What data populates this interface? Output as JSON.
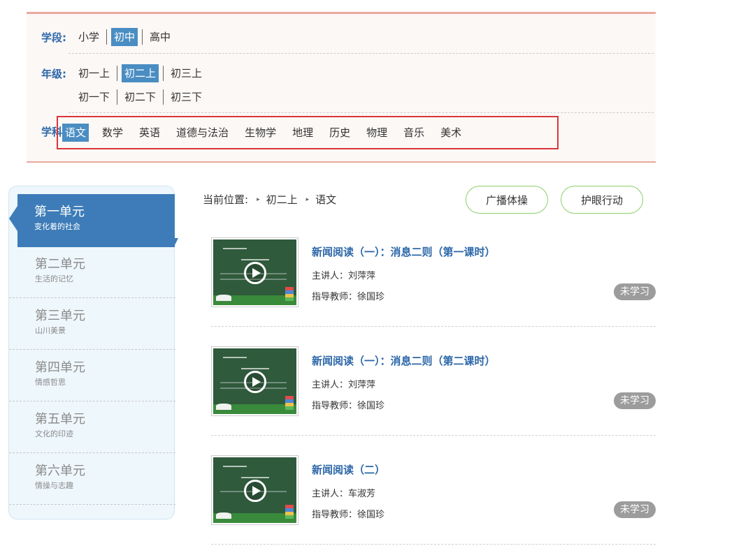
{
  "filters": {
    "stage": {
      "label": "学段:",
      "options": [
        "小学",
        "初中",
        "高中"
      ],
      "selected": "初中"
    },
    "grade": {
      "label": "年级:",
      "row1": [
        "初一上",
        "初二上",
        "初三上"
      ],
      "row2": [
        "初一下",
        "初二下",
        "初三下"
      ],
      "selected": "初二上"
    },
    "subject": {
      "label": "学科:",
      "options": [
        "语文",
        "数学",
        "英语",
        "道德与法治",
        "生物学",
        "地理",
        "历史",
        "物理",
        "音乐",
        "美术"
      ],
      "selected": "语文"
    }
  },
  "units": [
    {
      "title": "第一单元",
      "subtitle": "变化着的社会",
      "active": true
    },
    {
      "title": "第二单元",
      "subtitle": "生活的记忆",
      "active": false
    },
    {
      "title": "第三单元",
      "subtitle": "山川美景",
      "active": false
    },
    {
      "title": "第四单元",
      "subtitle": "情感哲思",
      "active": false
    },
    {
      "title": "第五单元",
      "subtitle": "文化的印迹",
      "active": false
    },
    {
      "title": "第六单元",
      "subtitle": "情操与志趣",
      "active": false
    }
  ],
  "breadcrumb": {
    "label": "当前位置:",
    "grade": "初二上",
    "subject": "语文"
  },
  "actions": {
    "exercise": "广播体操",
    "eye_care": "护眼行动"
  },
  "lessons": [
    {
      "title": "新闻阅读（一）：消息二则（第一课时）",
      "presenter": "主讲人：刘萍萍",
      "advisor": "指导教师：徐国珍",
      "status": "未学习"
    },
    {
      "title": "新闻阅读（一）：消息二则（第二课时）",
      "presenter": "主讲人：刘萍萍",
      "advisor": "指导教师：徐国珍",
      "status": "未学习"
    },
    {
      "title": "新闻阅读（二）",
      "presenter": "主讲人：车淑芳",
      "advisor": "指导教师：徐国珍",
      "status": "未学习"
    }
  ],
  "colors": {
    "accent_blue": "#3d7cb8",
    "title_blue": "#2c67a8",
    "highlight_red": "#d9363a",
    "pill_green": "#8bcf69",
    "status_gray": "#9c9c9c"
  },
  "icons": {
    "play": "play-circle-icon",
    "unit_pointer": "arrow-left-icon"
  }
}
